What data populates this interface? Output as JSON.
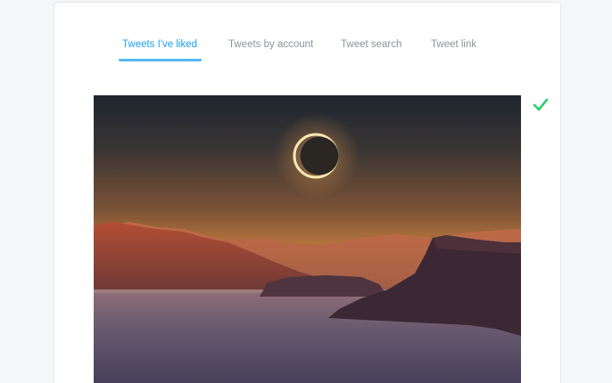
{
  "tabs": [
    {
      "label": "Tweets I've liked",
      "active": true
    },
    {
      "label": "Tweets by account",
      "active": false
    },
    {
      "label": "Tweet search",
      "active": false
    },
    {
      "label": "Tweet link",
      "active": false
    }
  ],
  "media": {
    "icon": "eclipse-landscape-photo"
  },
  "selection": {
    "icon": "checkmark-icon",
    "color": "#2ecc71",
    "selected": true
  },
  "colors": {
    "accent": "#1da1f2",
    "tab_inactive": "#8c939b",
    "card_bg": "#ffffff",
    "page_bg": "#f4f6f8"
  }
}
